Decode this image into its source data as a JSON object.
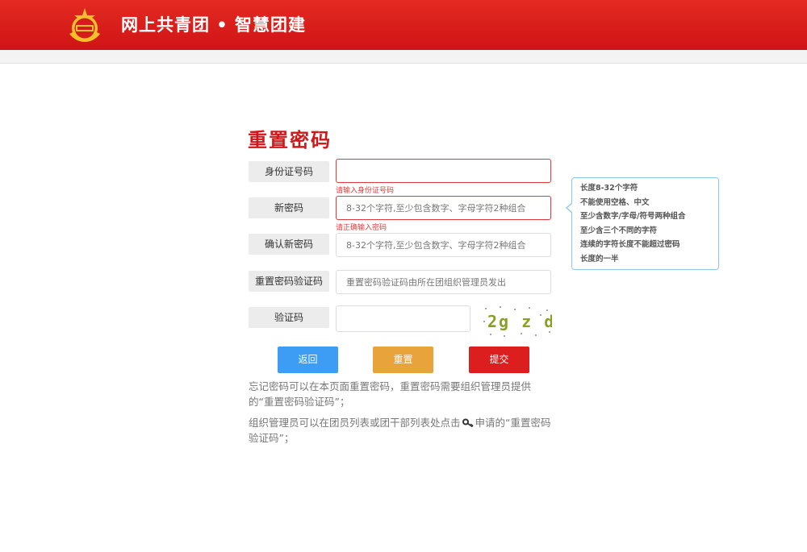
{
  "header": {
    "site_title": "网上共青团 • 智慧团建"
  },
  "form": {
    "title": "重置密码",
    "fields": [
      {
        "label": "身份证号码",
        "value": "",
        "placeholder": "",
        "error": "请输入身份证号码"
      },
      {
        "label": "新密码",
        "value": "",
        "placeholder": "8-32个字符,至少包含数字、字母字符2种组合",
        "error": "请正确输入密码"
      },
      {
        "label": "确认新密码",
        "value": "",
        "placeholder": "8-32个字符,至少包含数字、字母字符2种组合"
      },
      {
        "label": "重置密码验证码",
        "value": "",
        "placeholder": "重置密码验证码由所在团组织管理员发出"
      },
      {
        "label": "验证码",
        "value": "",
        "placeholder": ""
      }
    ],
    "captcha_text": "2g z d.",
    "buttons": {
      "back": "返回",
      "reset": "重置",
      "submit": "提交"
    }
  },
  "tooltip": {
    "lines": [
      "长度8-32个字符",
      "不能使用空格、中文",
      "至少含数字/字母/符号两种组合",
      "至少含三个不同的字符",
      "连续的字符长度不能超过密码",
      "长度的一半"
    ]
  },
  "notes": {
    "note1": "忘记密码可以在本页面重置密码，重置密码需要组织管理员提供的“重置密码验证码”；",
    "note2_before": "组织管理员可以在团员列表或团干部列表处点击",
    "note2_after": "申请的“重置密码验证码”；"
  },
  "colors": {
    "header_red": "#d91a1a",
    "title_red": "#d0181a",
    "error_red": "#e0393b",
    "back_blue": "#3d9df4",
    "reset_orange": "#e8a33a",
    "submit_red": "#dd1e1e",
    "tooltip_border": "#8fc8ef"
  },
  "icons": {
    "logo": "youth-league-emblem",
    "key": "key-icon"
  }
}
